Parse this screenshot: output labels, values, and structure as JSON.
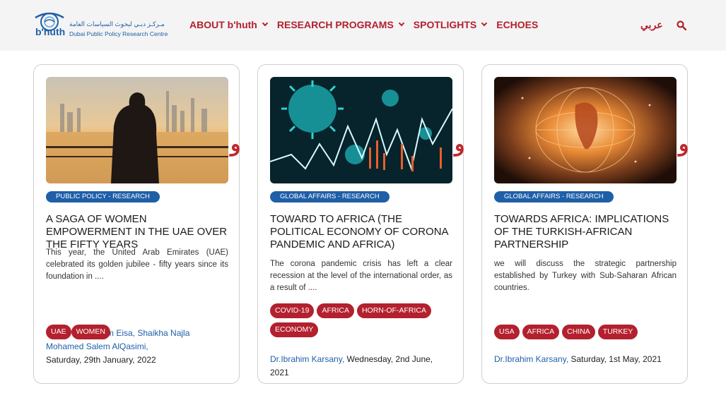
{
  "header": {
    "logo_text": "b'huth",
    "logo_arabic": "مـركـز دبـي لبحوث السياسات العامة",
    "logo_sub": "Dubai Public Policy Research Centre",
    "nav": [
      {
        "label": "ABOUT b'huth"
      },
      {
        "label": "RESEARCH PROGRAMS"
      },
      {
        "label": "SPOTLIGHTS"
      },
      {
        "label": "ECHOES"
      }
    ],
    "lang_label": "عربي",
    "accent_color": "#b3202e",
    "brand_color": "#1f5fa8"
  },
  "cards": [
    {
      "category": "PUBLIC POLICY - RESEARCH",
      "title": "A SAGA OF WOMEN EMPOWERMENT IN THE UAE OVER THE FIFTY YEARS",
      "excerpt": "This year, the United Arab Emirates (UAE) celebrated its golden jubilee - fifty years since its foundation in ....",
      "tags": [
        "UAE",
        "WOMEN"
      ],
      "authors_partial": "m Eisa, Shaikha Najla Mohamed Salem AlQasimi,",
      "date": "Saturday, 29th January, 2022",
      "badge": "و"
    },
    {
      "category": "GLOBAL AFFAIRS - RESEARCH",
      "title": "TOWARD TO AFRICA (THE POLITICAL ECONOMY OF CORONA PANDEMIC AND AFRICA)",
      "excerpt": "The corona pandemic crisis has left a clear recession at the level of the international order, as a result of ....",
      "tags": [
        "COVID-19",
        "AFRICA",
        "HORN-OF-AFRICA",
        "ECONOMY"
      ],
      "author": "Dr.Ibrahim Karsany,",
      "date": "Wednesday, 2nd June, 2021",
      "badge": "و"
    },
    {
      "category": "GLOBAL AFFAIRS - RESEARCH",
      "title": "TOWARDS AFRICA: IMPLICATIONS OF THE TURKISH-AFRICAN PARTNERSHIP",
      "excerpt": "we will discuss the strategic partnership established by Turkey with Sub-Saharan African countries.",
      "tags": [
        "USA",
        "AFRICA",
        "CHINA",
        "TURKEY"
      ],
      "author": "Dr.Ibrahim Karsany,",
      "date": "Saturday, 1st May, 2021",
      "badge": "و"
    }
  ]
}
